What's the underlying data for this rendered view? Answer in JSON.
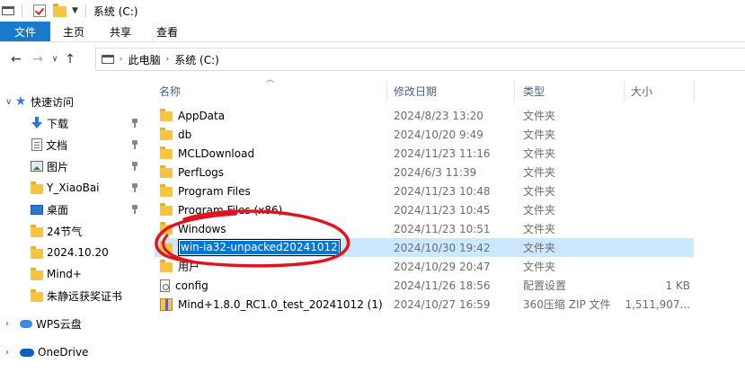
{
  "window": {
    "title": "系统 (C:)"
  },
  "ribbon": {
    "tabs": [
      {
        "label": "文件"
      },
      {
        "label": "主页"
      },
      {
        "label": "共享"
      },
      {
        "label": "查看"
      }
    ]
  },
  "address": {
    "crumbs": [
      "此电脑",
      "系统 (C:)"
    ]
  },
  "columns": {
    "name": "名称",
    "date": "修改日期",
    "type": "类型",
    "size": "大小"
  },
  "sidebar": {
    "quick_access": "快速访问",
    "items": [
      {
        "label": "下载",
        "icon": "download-icon",
        "pinned": true
      },
      {
        "label": "文档",
        "icon": "document-icon",
        "pinned": true
      },
      {
        "label": "图片",
        "icon": "picture-icon",
        "pinned": true
      },
      {
        "label": "Y_XiaoBai",
        "icon": "folder-icon",
        "pinned": true
      },
      {
        "label": "桌面",
        "icon": "desktop-icon",
        "pinned": true
      },
      {
        "label": "24节气",
        "icon": "folder-icon",
        "pinned": false
      },
      {
        "label": "2024.10.20",
        "icon": "folder-icon",
        "pinned": false
      },
      {
        "label": "Mind+",
        "icon": "folder-icon",
        "pinned": false
      },
      {
        "label": "朱静远获奖证书",
        "icon": "folder-icon",
        "pinned": false
      }
    ],
    "wps": "WPS云盘",
    "onedrive": "OneDrive"
  },
  "files": [
    {
      "name": "AppData",
      "date": "2024/8/23 13:20",
      "type": "文件夹",
      "size": "",
      "icon": "folder-icon"
    },
    {
      "name": "db",
      "date": "2024/10/20 9:49",
      "type": "文件夹",
      "size": "",
      "icon": "folder-icon"
    },
    {
      "name": "MCLDownload",
      "date": "2024/11/23 11:16",
      "type": "文件夹",
      "size": "",
      "icon": "folder-icon"
    },
    {
      "name": "PerfLogs",
      "date": "2024/6/3 11:39",
      "type": "文件夹",
      "size": "",
      "icon": "folder-icon"
    },
    {
      "name": "Program Files",
      "date": "2024/11/23 10:48",
      "type": "文件夹",
      "size": "",
      "icon": "folder-icon"
    },
    {
      "name": "Program Files (x86)",
      "date": "2024/11/23 10:45",
      "type": "文件夹",
      "size": "",
      "icon": "folder-icon"
    },
    {
      "name": "Windows",
      "date": "2024/11/23 10:51",
      "type": "文件夹",
      "size": "",
      "icon": "folder-icon"
    },
    {
      "name": "win-ia32-unpacked20241012",
      "date": "2024/10/30 19:42",
      "type": "文件夹",
      "size": "",
      "icon": "folder-icon",
      "renaming": true
    },
    {
      "name": "用户",
      "date": "2024/10/29 20:47",
      "type": "文件夹",
      "size": "",
      "icon": "folder-icon"
    },
    {
      "name": "config",
      "date": "2024/11/26 18:56",
      "type": "配置设置",
      "size": "1 KB",
      "icon": "config-file-icon"
    },
    {
      "name": "Mind+1.8.0_RC1.0_test_20241012 (1)",
      "date": "2024/10/27 16:59",
      "type": "360压缩 ZIP 文件",
      "size": "1,511,907...",
      "icon": "zip-icon"
    }
  ],
  "colors": {
    "file_tab": "#1979ca",
    "selection": "#cce8ff",
    "annotation": "#e0141e"
  }
}
